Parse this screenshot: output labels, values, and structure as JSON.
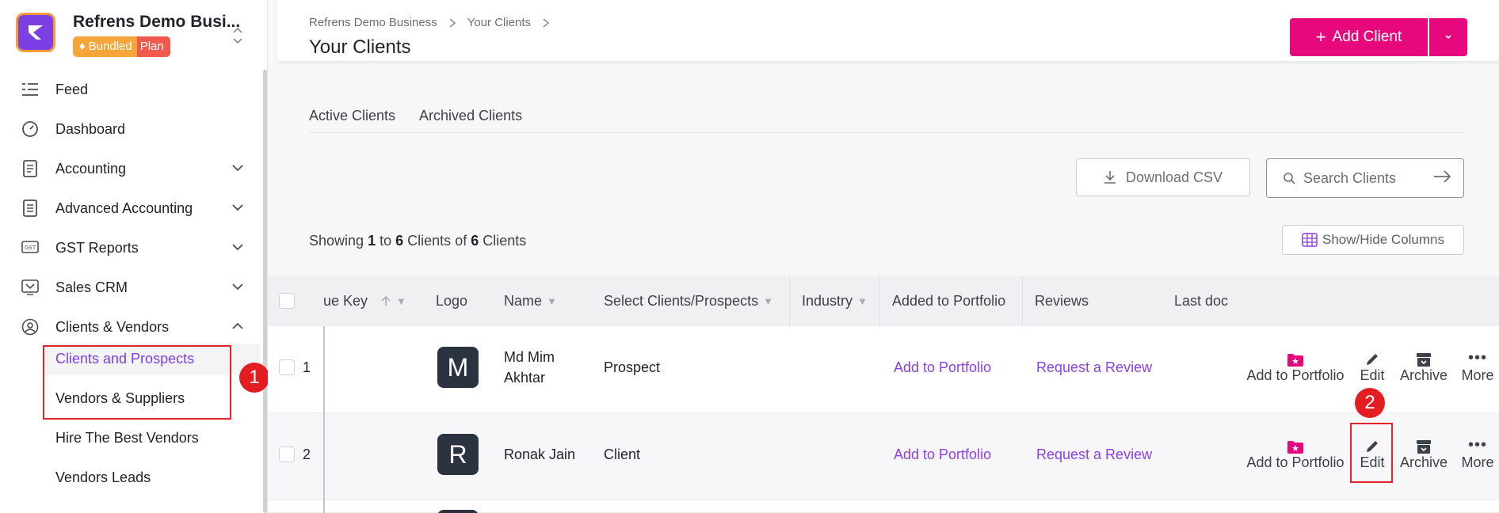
{
  "workspace": {
    "name": "Refrens Demo Busi...",
    "plan_a": "Bundled",
    "plan_b": "Plan"
  },
  "colors": {
    "accent": "#e8087d",
    "brand": "#7b3fe4",
    "link": "#8e3fe0",
    "annotation": "#e0262b"
  },
  "sidebar": {
    "items": [
      {
        "label": "Feed",
        "icon": "feed-icon"
      },
      {
        "label": "Dashboard",
        "icon": "dashboard-icon"
      },
      {
        "label": "Accounting",
        "icon": "accounting-icon"
      },
      {
        "label": "Advanced Accounting",
        "icon": "advanced-accounting-icon"
      },
      {
        "label": "GST Reports",
        "icon": "gst-icon"
      },
      {
        "label": "Sales CRM",
        "icon": "sales-crm-icon"
      },
      {
        "label": "Clients & Vendors",
        "icon": "clients-vendors-icon"
      }
    ],
    "subitems": [
      {
        "label": "Clients and Prospects"
      },
      {
        "label": "Vendors & Suppliers"
      },
      {
        "label": "Hire The Best Vendors"
      },
      {
        "label": "Vendors Leads"
      }
    ]
  },
  "header": {
    "breadcrumbs": [
      "Refrens Demo Business",
      "Your Clients"
    ],
    "title": "Your Clients",
    "add_button": "Add Client"
  },
  "tabs": [
    "Active Clients",
    "Archived Clients"
  ],
  "toolbar": {
    "download_csv": "Download CSV",
    "search_placeholder": "Search Clients",
    "show_hide": "Show/Hide Columns"
  },
  "showing": {
    "prefix": "Showing",
    "from": "1",
    "to_word": "to",
    "to": "6",
    "unit": "Clients",
    "of_word": "of",
    "total": "6",
    "unit2": "Clients"
  },
  "table": {
    "columns": [
      "ue Key",
      "Logo",
      "Name",
      "Select Clients/Prospects",
      "Industry",
      "Added to Portfolio",
      "Reviews",
      "Last doc"
    ],
    "rows": [
      {
        "num": "1",
        "logo": "M",
        "name": "Md Mim Akhtar",
        "type": "Prospect",
        "portfolio": "Add to Portfolio",
        "review": "Request a Review"
      },
      {
        "num": "2",
        "logo": "R",
        "name": "Ronak Jain",
        "type": "Client",
        "portfolio": "Add to Portfolio",
        "review": "Request a Review"
      }
    ],
    "actions": {
      "portfolio": "Add to Portfolio",
      "edit": "Edit",
      "archive": "Archive",
      "more": "More"
    }
  },
  "annotations": {
    "one": "1",
    "two": "2"
  }
}
